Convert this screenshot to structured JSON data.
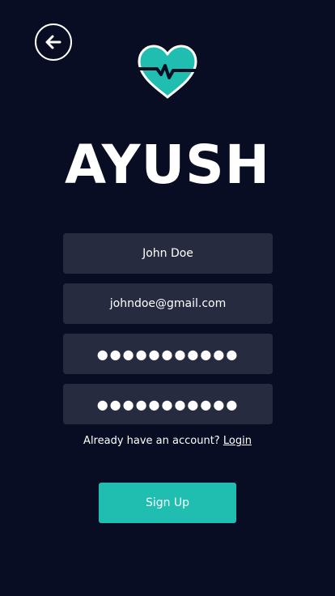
{
  "header": {
    "back_icon": "arrow-left-circle-icon",
    "logo_icon": "heart-pulse-icon"
  },
  "brand": {
    "name": "AYUSH"
  },
  "form": {
    "name_value": "John Doe",
    "email_value": "johndoe@gmail.com",
    "password_value": "●●●●●●●●●●●",
    "confirm_password_value": "●●●●●●●●●●●"
  },
  "login_prompt": {
    "text": "Already have an account?",
    "link": "Login"
  },
  "signup_button": {
    "label": "Sign Up"
  },
  "colors": {
    "background": "#090d24",
    "field": "#272b40",
    "accent": "#1fbeb0",
    "text": "#ffffff"
  }
}
